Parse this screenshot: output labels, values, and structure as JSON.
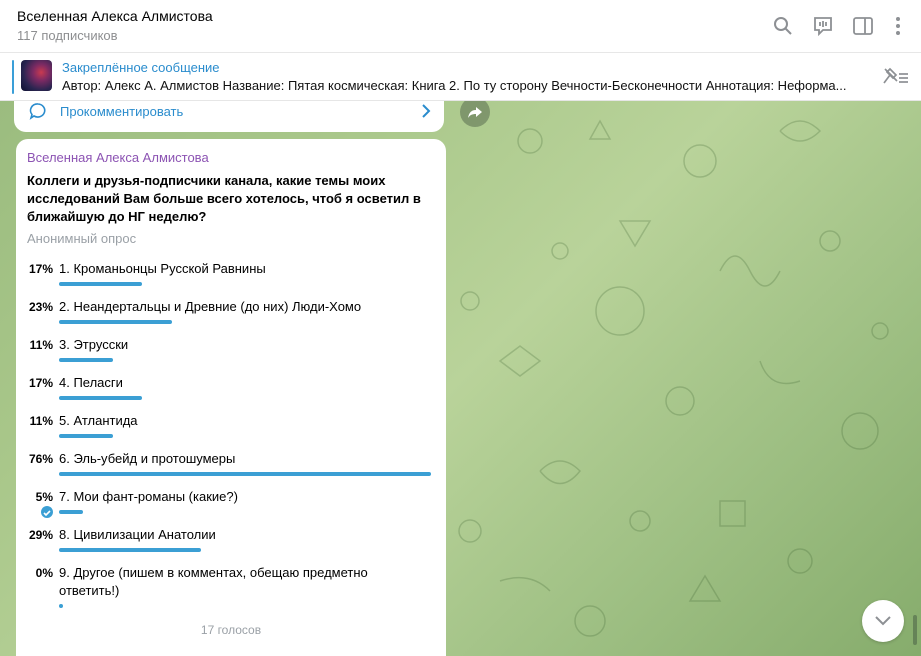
{
  "header": {
    "title": "Вселенная Алекса Алмистова",
    "subtitle": "117 подписчиков",
    "icons": [
      "search-icon",
      "comments-icon",
      "sidebar-toggle-icon",
      "more-vert-icon"
    ]
  },
  "pinned": {
    "title": "Закреплённое сообщение",
    "text": "Автор: Алекс А. Алмистов Название: Пятая космическая: Книга 2. По ту сторону Вечности-Бесконечности Аннотация: Неформа..."
  },
  "comment": {
    "label": "Прокомментировать"
  },
  "poll": {
    "author": "Вселенная Алекса Алмистова",
    "question": "Коллеги и друзья-подписчики канала, какие темы моих исследований Вам больше всего хотелось, чтоб я осветил в ближайшую до НГ неделю?",
    "type": "Анонимный опрос",
    "options": [
      {
        "pct": "17%",
        "value": 17,
        "label": "1. Кроманьонцы Русской Равнины"
      },
      {
        "pct": "23%",
        "value": 23,
        "label": "2. Неандертальцы и Древние (до них) Люди-Хомо"
      },
      {
        "pct": "11%",
        "value": 11,
        "label": "3. Этрусски"
      },
      {
        "pct": "17%",
        "value": 17,
        "label": "4. Пеласги"
      },
      {
        "pct": "11%",
        "value": 11,
        "label": "5. Атлантида"
      },
      {
        "pct": "76%",
        "value": 76,
        "label": "6. Эль-убейд и протошумеры"
      },
      {
        "pct": "5%",
        "value": 5,
        "label": "7. Мои фант-романы (какие?)",
        "chosen": true
      },
      {
        "pct": "29%",
        "value": 29,
        "label": "8. Цивилизации Анатолии"
      },
      {
        "pct": "0%",
        "value": 0,
        "label": "9. Другое (пишем в комментах, обещаю предметно ответить!)"
      }
    ],
    "votes": "17 голосов"
  },
  "colors": {
    "accent": "#3b9fd4",
    "author": "#8c53b3",
    "link": "#2a8ccd"
  }
}
